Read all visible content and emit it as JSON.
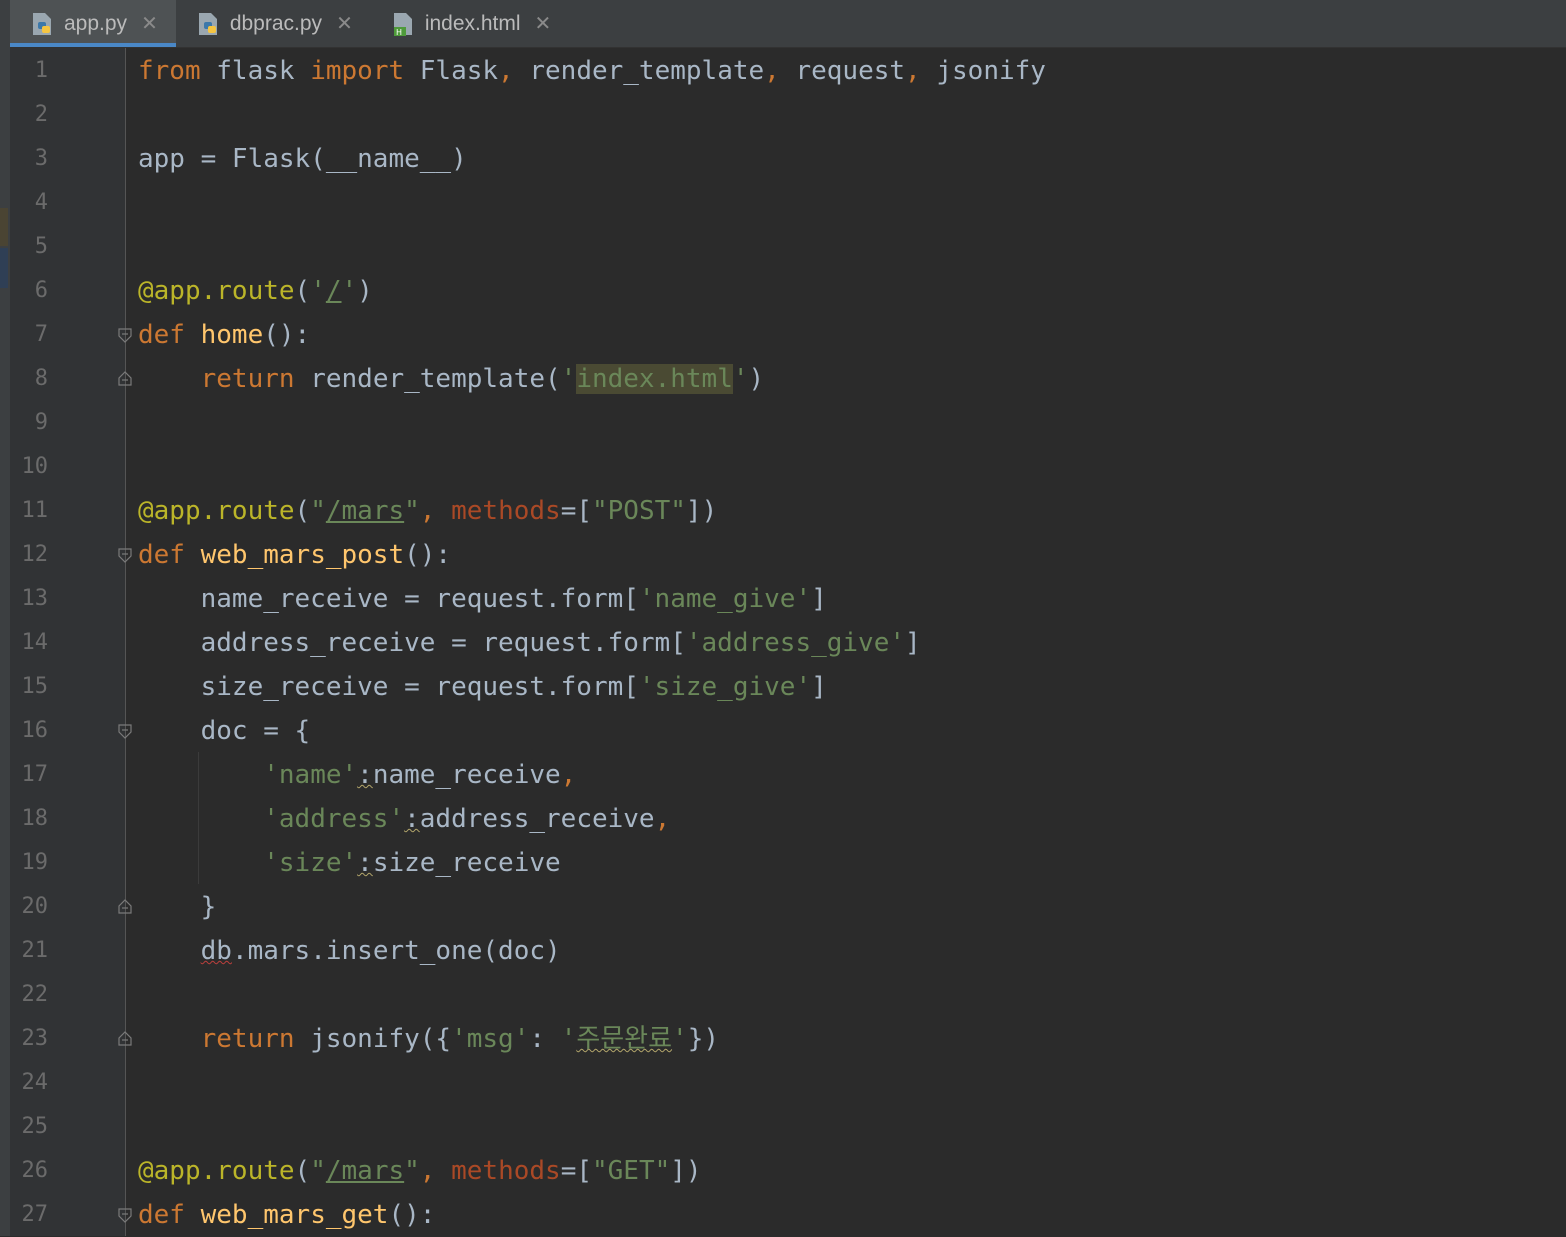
{
  "tabs": [
    {
      "label": "app.py",
      "icon": "python-file-icon",
      "active": true
    },
    {
      "label": "dbprac.py",
      "icon": "python-file-icon",
      "active": false
    },
    {
      "label": "index.html",
      "icon": "html-file-icon",
      "active": false
    }
  ],
  "close_glyph": "✕",
  "line_numbers": [
    "1",
    "2",
    "3",
    "4",
    "5",
    "6",
    "7",
    "8",
    "9",
    "10",
    "11",
    "12",
    "13",
    "14",
    "15",
    "16",
    "17",
    "18",
    "19",
    "20",
    "21",
    "22",
    "23",
    "24",
    "25",
    "26",
    "27"
  ],
  "code": {
    "l1": {
      "from": "from",
      "flask": " flask ",
      "import": "import",
      "rest1": " Flask",
      "c1": ",",
      "rest2": " render_template",
      "c2": ",",
      "rest3": " request",
      "c3": ",",
      "rest4": " jsonify"
    },
    "l3": {
      "text": "app = Flask(__name__)"
    },
    "l6": {
      "dec": "@app.route",
      "p1": "(",
      "q1": "'",
      "path": "/",
      "q2": "'",
      "p2": ")"
    },
    "l7": {
      "def": "def",
      "name": " home",
      "rest": "():"
    },
    "l8": {
      "indent": "    ",
      "ret": "return",
      "call": " render_template(",
      "q1": "'",
      "arg": "index.html",
      "q2": "'",
      "close": ")"
    },
    "l11": {
      "dec": "@app.route",
      "p1": "(",
      "q1": "\"",
      "path": "/mars",
      "q2": "\"",
      "c": ",",
      "sp": " ",
      "kw": "methods",
      "eq": "=[",
      "method": "\"POST\"",
      "close": "])"
    },
    "l12": {
      "def": "def",
      "name": " web_mars_post",
      "rest": "():"
    },
    "l13": {
      "pre": "    name_receive = request.form[",
      "key": "'name_give'",
      "post": "]"
    },
    "l14": {
      "pre": "    address_receive = request.form[",
      "key": "'address_give'",
      "post": "]"
    },
    "l15": {
      "pre": "    size_receive = request.form[",
      "key": "'size_give'",
      "post": "]"
    },
    "l16": {
      "text": "    doc = {"
    },
    "l17": {
      "indent": "        ",
      "key": "'name'",
      "colon": ":",
      "val": "name_receive",
      "comma": ","
    },
    "l18": {
      "indent": "        ",
      "key": "'address'",
      "colon": ":",
      "val": "address_receive",
      "comma": ","
    },
    "l19": {
      "indent": "        ",
      "key": "'size'",
      "colon": ":",
      "val": "size_receive"
    },
    "l20": {
      "text": "    }"
    },
    "l21": {
      "indent": "    ",
      "db": "db",
      "rest": ".mars.insert_one(doc)"
    },
    "l23": {
      "indent": "    ",
      "ret": "return",
      "call": " jsonify({",
      "key": "'msg'",
      "colon": ": ",
      "q1": "'",
      "msg": "주문완료",
      "q2": "'",
      "close": "})"
    },
    "l26": {
      "dec": "@app.route",
      "p1": "(",
      "q1": "\"",
      "path": "/mars",
      "q2": "\"",
      "c": ",",
      "sp": " ",
      "kw": "methods",
      "eq": "=[",
      "method": "\"GET\"",
      "close": "])"
    },
    "l27": {
      "def": "def",
      "name": " web_mars_get",
      "rest": "():"
    }
  },
  "colors": {
    "background": "#2b2b2b",
    "keyword": "#cc7832",
    "function": "#ffc66d",
    "decorator": "#bbb529",
    "string": "#6a8759",
    "parameter": "#aa4926",
    "default_text": "#a9b7c6",
    "tab_accent": "#4a88c7"
  }
}
